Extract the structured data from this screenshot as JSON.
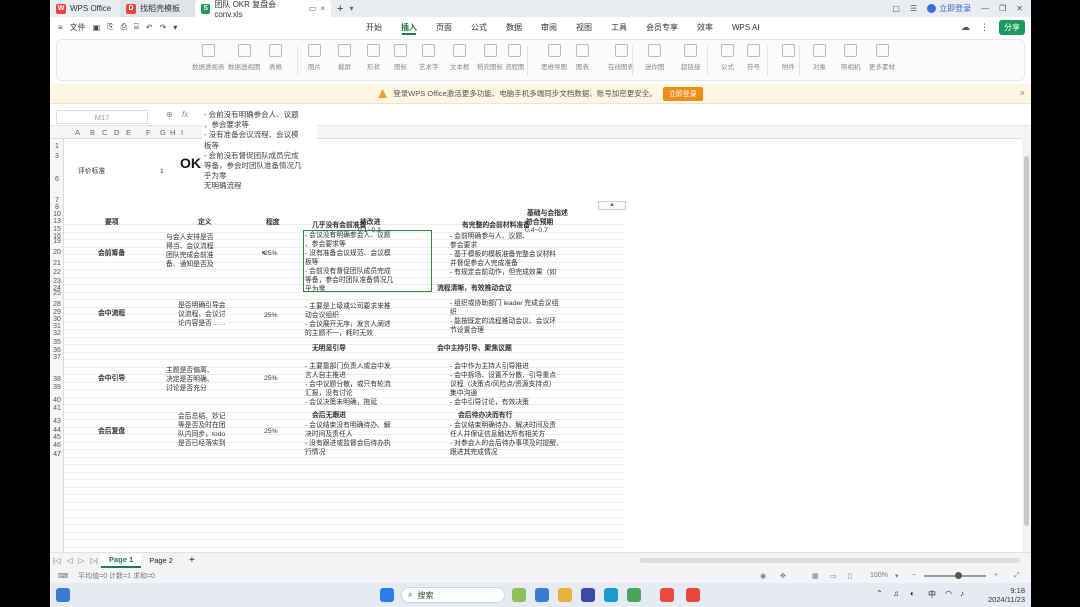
{
  "tabs": [
    {
      "label": "WPS Office",
      "icon": "W",
      "color": "#e8463b"
    },
    {
      "label": "找稻壳模板",
      "icon": "D",
      "color": "#e8463b"
    },
    {
      "label": "团队 OKR 复盘会 conv.xls",
      "icon": "S",
      "color": "#1a9b5c"
    }
  ],
  "titlebar": {
    "login": "立即登录",
    "add": "+"
  },
  "menu": {
    "file": "文件",
    "tabs": [
      "开始",
      "插入",
      "页面",
      "公式",
      "数据",
      "审阅",
      "视图",
      "工具",
      "会员专享",
      "效率",
      "WPS AI"
    ],
    "active": "插入",
    "share": "分享"
  },
  "ribbon": [
    "数据透视表",
    "数据透视图",
    "表格",
    "图片",
    "截屏",
    "形状",
    "图标",
    "艺术字",
    "文本框",
    "稻壳图标",
    "流程图",
    "思维导图",
    "图表",
    "在线图表",
    "迷你图",
    "超链接",
    "公式",
    "符号",
    "附件",
    "对象",
    "照相机",
    "更多素材"
  ],
  "notice": {
    "text": "登录WPS Office激活更多功能、电脑手机多端同步文档数据、账号加密更安全。",
    "button": "立即登录",
    "close": "×"
  },
  "formula": {
    "namebox": "M17",
    "fx": "fx",
    "content": [
      "- 会前没有明确参会人、议题",
      "、参会要求等",
      "- 没有准备会议流程、会议模",
      "板等",
      "- 会前没有督促团队成员完成",
      "等备，参会时团队准备情况几",
      "乎为零",
      "无明确流程"
    ]
  },
  "columns": [
    "A",
    "B",
    "C",
    "D",
    "E",
    "F",
    "G",
    "H",
    "I"
  ],
  "rows": [
    "1",
    "3",
    "6",
    "7",
    "8",
    "10",
    "13",
    "15",
    "16",
    "19",
    "20",
    "21",
    "22",
    "23",
    "24",
    "25",
    "28",
    "29",
    "30",
    "31",
    "32",
    "35",
    "36",
    "37",
    "38",
    "39",
    "40",
    "41",
    "43",
    "44",
    "45",
    "46",
    "47"
  ],
  "sheet": {
    "title": "OKR",
    "a3": "评价标准",
    "a3v": "1",
    "toprightgroup": "基础与会指述",
    "headers": [
      "要项",
      "定义",
      "程度",
      "待改进",
      "符合预期"
    ],
    "range1": "0.1~0.3",
    "range2": "0.4~0.7",
    "sec1": {
      "h1": "几乎没有会前准备",
      "h2": "有完整的会前材料准备",
      "name": "会前筹备",
      "def": [
        "与会人安排是否",
        "得当、会议流程",
        "团队完成会前准",
        "备、通知是否及"
      ],
      "deg": "25%",
      "c1": [
        "- 会议没有明确参会人、议题",
        "、参会要求等",
        "- 没有准备会议规范、会议模",
        "板等",
        "- 会前没有督促团队成员完成",
        "等备，参会时团队准备情况几",
        "乎为零"
      ],
      "c2": [
        "- 会前明确参与人、议题、",
        "参会要求",
        "- 基于模板的模板准备完整会议材料",
        "并督促参会人完成准备",
        "- 有规定会前动作，但完成效果（如"
      ]
    },
    "sec2": {
      "h2": "流程清晰，有效推动会议",
      "name": "会中流程",
      "def": [
        "是否明确引导会",
        "议流程、会议讨",
        "论内容是否……"
      ],
      "deg": "25%",
      "c1": [
        "- 主要是上级或公司要求来推",
        "动会议组织",
        "- 会议展开无序，发言人阐述",
        "的主题不一，耗时无效"
      ],
      "c2": [
        "- 组织或协助部门 leader 完成会议组",
        "织",
        "- 能按既定的流程推动会议、会议环",
        "节设置合理"
      ]
    },
    "sec3": {
      "h1": "无明显引导",
      "h2": "会中主持引导、聚焦议题",
      "name": "会中引导",
      "def": [
        "主题是否偏离、",
        "决定是否明确、",
        "讨论是否充分"
      ],
      "deg": "25%",
      "c1": [
        "- 主要靠部门负责人或会中发",
        "言人自主推进",
        "- 会中议题分散，或只有轮流",
        "汇报，没有讨论",
        "- 会议决策未明确，拖延"
      ],
      "c2": [
        "- 会中作为主持人引导推进",
        "- 会中拆场、设置不分散、引导重点",
        "议程（决策点/风险点/资源支持点）",
        "集中沟通",
        "- 会中引导讨论，有效决策"
      ]
    },
    "sec4": {
      "h1": "会后无跟进",
      "h2": "会后待办决而有行",
      "name": "会后复盘",
      "def": [
        "会后总结、妙记",
        "等是否及时在团",
        "队内同步，todo",
        "是否已经落实到"
      ],
      "deg": "25%",
      "c1": [
        "- 会议结束没有明确待办、解",
        "决时间及责任人",
        "- 没有跟进或监督会后待办执",
        "行情况"
      ],
      "c2": [
        "- 会议结束明确待办、解决时间及责",
        "任人并保证信息触达所有相关方",
        "- 对参会人的会后待办事项及时提醒、",
        "跟进其完成情况"
      ]
    }
  },
  "sheettabs": [
    "Page 1",
    "Page 2",
    "+"
  ],
  "activesheet": "Page 1",
  "status": {
    "left": "平均值=0  计数=1  求和=0",
    "zoom": "100%"
  },
  "taskbar": {
    "search": "搜索",
    "ime": "中",
    "time": "9:18",
    "date": "2024/11/23"
  }
}
